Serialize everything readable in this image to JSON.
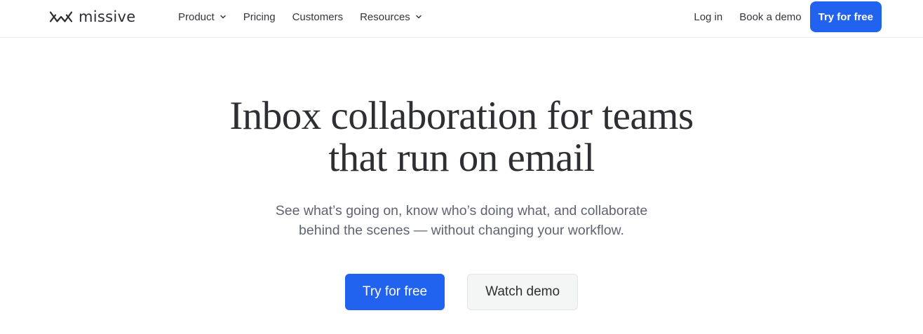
{
  "header": {
    "logo_text": "missive",
    "logo_icon": "missive-logo-icon",
    "nav": [
      {
        "label": "Product",
        "has_dropdown": true
      },
      {
        "label": "Pricing",
        "has_dropdown": false
      },
      {
        "label": "Customers",
        "has_dropdown": false
      },
      {
        "label": "Resources",
        "has_dropdown": true
      }
    ],
    "login_label": "Log in",
    "book_demo_label": "Book a demo",
    "try_free_label": "Try for free"
  },
  "hero": {
    "title_line1": "Inbox collaboration for teams",
    "title_line2": "that run on email",
    "subtitle_line1": "See what’s going on, know who’s doing what, and collaborate",
    "subtitle_line2": "behind the scenes — without changing your workflow.",
    "cta_primary_label": "Try for free",
    "cta_secondary_label": "Watch demo"
  },
  "colors": {
    "accent": "#2163ee",
    "text_dark": "#2e2f33",
    "text_muted": "#5f6472",
    "secondary_button_bg": "#f4f5f5"
  }
}
